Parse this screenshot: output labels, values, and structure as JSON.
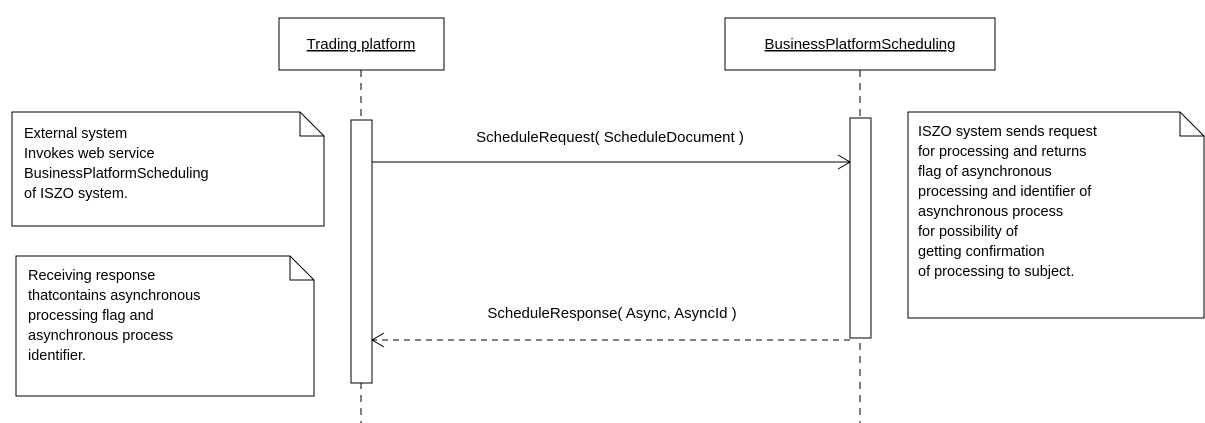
{
  "participants": {
    "trading": {
      "label": "Trading platform"
    },
    "scheduling": {
      "label": "BusinessPlatformScheduling"
    }
  },
  "messages": {
    "request": {
      "label": "ScheduleRequest( ScheduleDocument )"
    },
    "response": {
      "label": "ScheduleResponse( Async, AsyncId )"
    }
  },
  "notes": {
    "external": {
      "lines": [
        "External system",
        "Invokes web service",
        "BusinessPlatformScheduling",
        "of ISZO system."
      ]
    },
    "receiving": {
      "lines": [
        "Receiving response",
        "thatcontains asynchronous",
        "processing flag and",
        "asynchronous process",
        "identifier."
      ]
    },
    "iszo": {
      "lines": [
        "ISZO system sends request",
        "for processing and returns",
        "flag of asynchronous",
        "processing and identifier of",
        "asynchronous process",
        "for possibility of",
        "getting confirmation",
        "of processing to subject."
      ]
    }
  }
}
